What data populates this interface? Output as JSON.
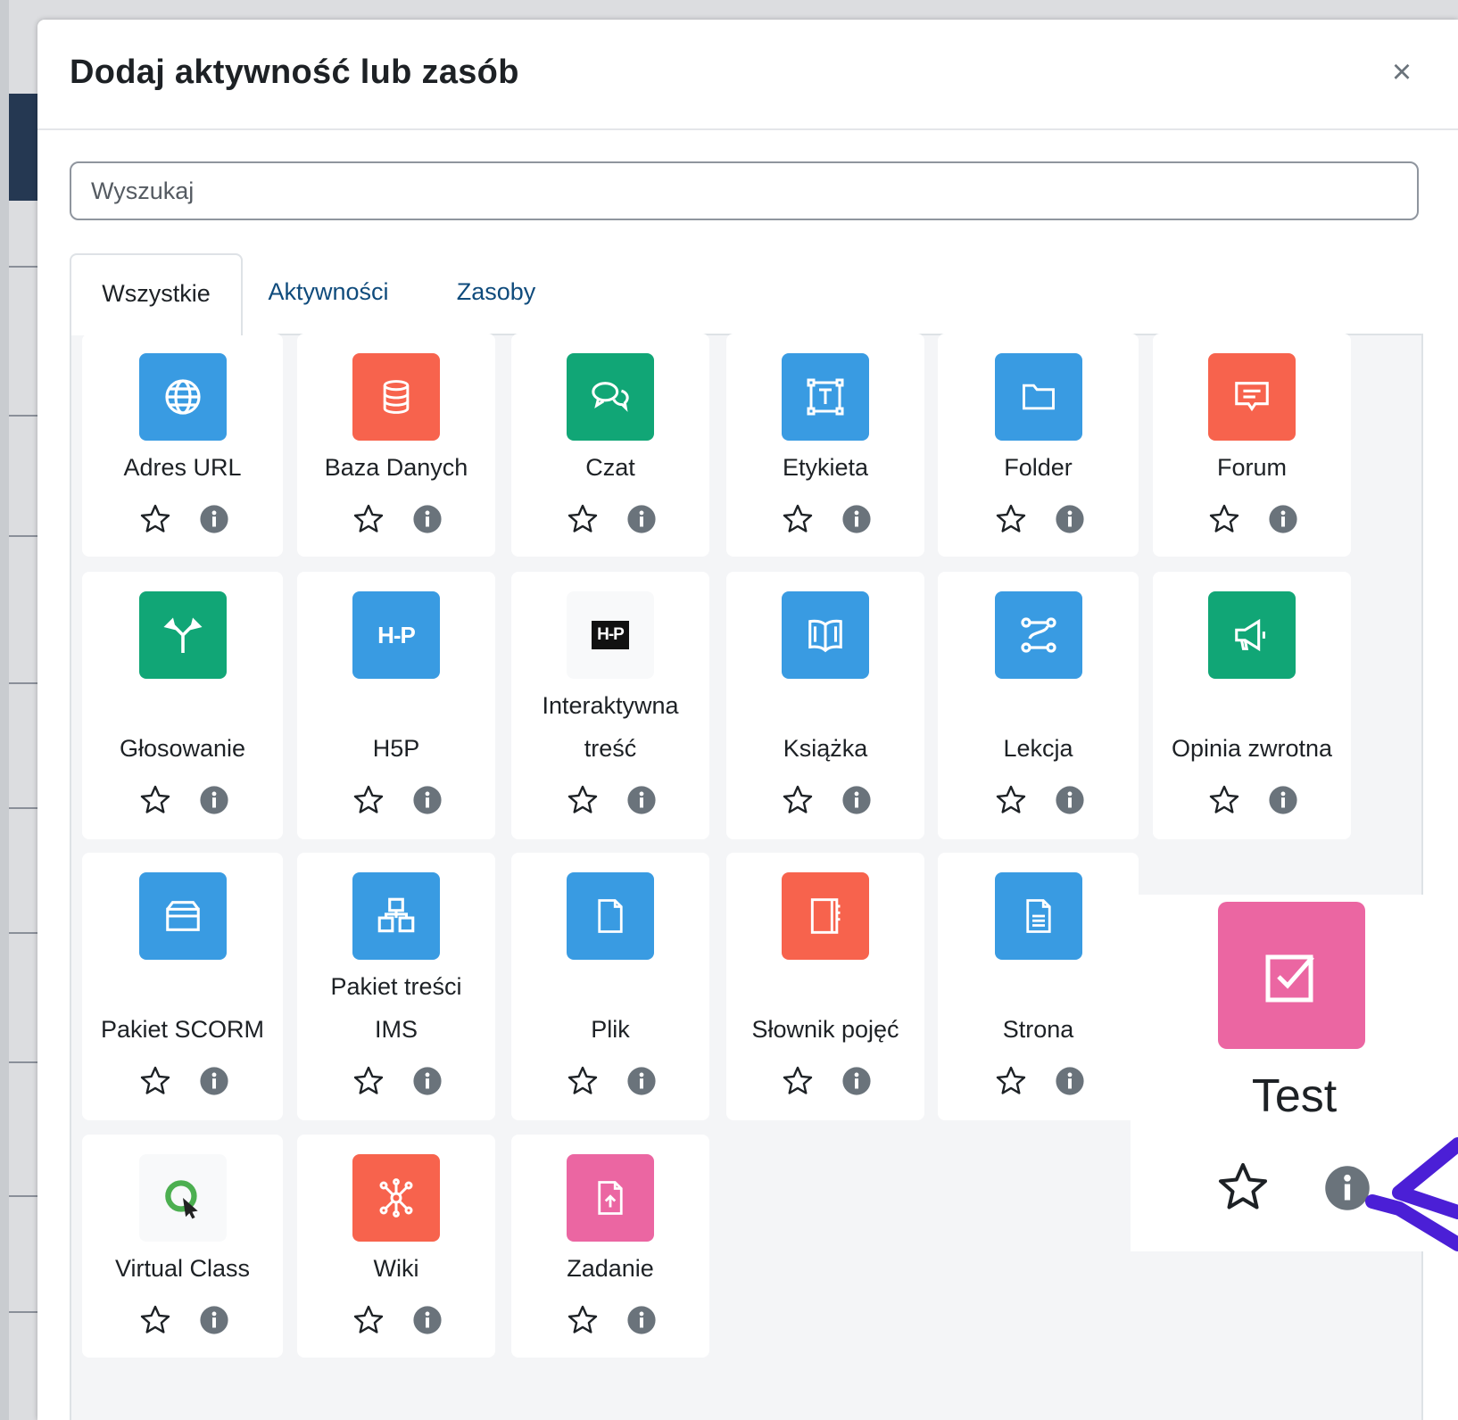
{
  "modal": {
    "title": "Dodaj aktywność lub zasób",
    "close_symbol": "×"
  },
  "search": {
    "placeholder": "Wyszukaj"
  },
  "tabs": [
    {
      "label": "Wszystkie",
      "active": true
    },
    {
      "label": "Aktywności",
      "active": false
    },
    {
      "label": "Zasoby",
      "active": false
    }
  ],
  "items": [
    {
      "label": "Adres URL",
      "icon": "globe-icon",
      "color": "#399be2"
    },
    {
      "label": "Baza Danych",
      "icon": "database-icon",
      "color": "#f7634d"
    },
    {
      "label": "Czat",
      "icon": "chat-icon",
      "color": "#11a676"
    },
    {
      "label": "Etykieta",
      "icon": "text-frame-icon",
      "color": "#399be2"
    },
    {
      "label": "Folder",
      "icon": "folder-icon",
      "color": "#399be2"
    },
    {
      "label": "Forum",
      "icon": "forum-icon",
      "color": "#f7634d"
    },
    {
      "label": "Głosowanie",
      "icon": "choice-icon",
      "color": "#11a676"
    },
    {
      "label": "H5P",
      "icon": "h5p-icon",
      "color": "#399be2"
    },
    {
      "label_lines": [
        "Interaktywna",
        "treść"
      ],
      "icon": "h5p-dark-icon",
      "color": "#f8f9fa"
    },
    {
      "label": "Książka",
      "icon": "book-icon",
      "color": "#399be2"
    },
    {
      "label": "Lekcja",
      "icon": "lesson-path-icon",
      "color": "#399be2"
    },
    {
      "label": "Opinia zwrotna",
      "icon": "megaphone-icon",
      "color": "#11a676"
    },
    {
      "label": "Pakiet SCORM",
      "icon": "box-icon",
      "color": "#399be2"
    },
    {
      "label_lines": [
        "Pakiet treści",
        "IMS"
      ],
      "icon": "package-cubes-icon",
      "color": "#399be2"
    },
    {
      "label": "Plik",
      "icon": "file-icon",
      "color": "#399be2"
    },
    {
      "label": "Słownik pojęć",
      "icon": "notebook-icon",
      "color": "#f7634d"
    },
    {
      "label": "Strona",
      "icon": "page-icon",
      "color": "#399be2"
    },
    {
      "label": "Virtual Class",
      "icon": "virtual-class-icon",
      "color": "#f8f9fa"
    },
    {
      "label": "Wiki",
      "icon": "wiki-icon",
      "color": "#f7634d"
    },
    {
      "label": "Zadanie",
      "icon": "assignment-icon",
      "color": "#eb66a2"
    }
  ],
  "zoom_item": {
    "label": "Test",
    "icon": "quiz-check-icon",
    "color": "#eb66a2"
  },
  "annotation_arrow_color": "#4b1fd6"
}
